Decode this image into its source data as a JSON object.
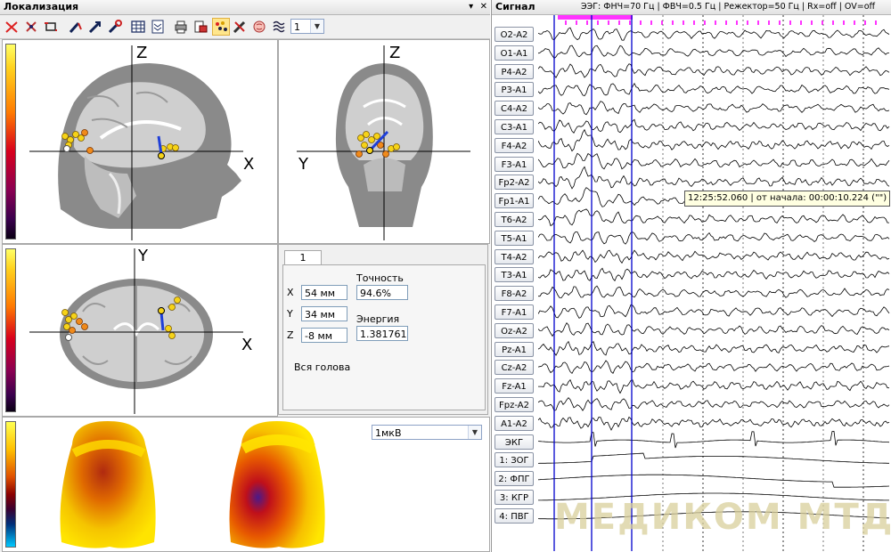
{
  "localization": {
    "title": "Локализация",
    "close_icon": "✕",
    "toolbar": {
      "icons": [
        "cut-red-icon",
        "cut-dipole-icon",
        "crop-icon",
        "dipole-blue-icon",
        "dipole-arrow-icon",
        "dipole-wrench-icon",
        "table-icon",
        "layers-icon",
        "print-icon",
        "export-icon",
        "dots-grid-icon",
        "tools-icon",
        "brain-icon",
        "signal-icon"
      ],
      "selected_index": 10,
      "dipole_count": "1"
    },
    "sagittal": {
      "x_label": "X",
      "z_label": "Z"
    },
    "coronal": {
      "y_label": "Y",
      "z_label": "Z"
    },
    "axial": {
      "x_label": "X",
      "y_label": "Y"
    },
    "info": {
      "tab": "1",
      "x_label": "X",
      "x_value": "54 мм",
      "y_label": "Y",
      "y_value": "34 мм",
      "z_label": "Z",
      "z_value": "-8 мм",
      "accuracy_label": "Точность",
      "accuracy_value": "94.6%",
      "energy_label": "Энергия",
      "energy_value": "1.381761",
      "region": "Вся голова"
    },
    "topo": {
      "scale": "1мкВ"
    }
  },
  "signal": {
    "title": "Сигнал",
    "filters": "ЭЭГ: ФНЧ=70 Гц | ФВЧ=0.5 Гц | Режектор=50 Гц | Rx=off | OV=off",
    "tooltip_time": "12:25:52.060",
    "tooltip_rest": " | от начала: 00:00:10.224 (\"\")",
    "channels": [
      "O2-A2",
      "O1-A1",
      "P4-A2",
      "P3-A1",
      "C4-A2",
      "C3-A1",
      "F4-A2",
      "F3-A1",
      "Fp2-A2",
      "Fp1-A1",
      "T6-A2",
      "T5-A1",
      "T4-A2",
      "T3-A1",
      "F8-A2",
      "F7-A1",
      "Oz-A2",
      "Pz-A1",
      "Cz-A2",
      "Fz-A1",
      "Fpz-A2",
      "A1-A2",
      "ЭКГ",
      "1: ЗОГ",
      "2: ФПГ",
      "3: КГР",
      "4: ПВГ"
    ],
    "watermark": "МЕДИКОМ МТД"
  },
  "colors": {
    "marker": "#ff33ff",
    "cursor": "#0000cc",
    "brain": "#8c8c8c",
    "highlight": "#ffe68c"
  }
}
